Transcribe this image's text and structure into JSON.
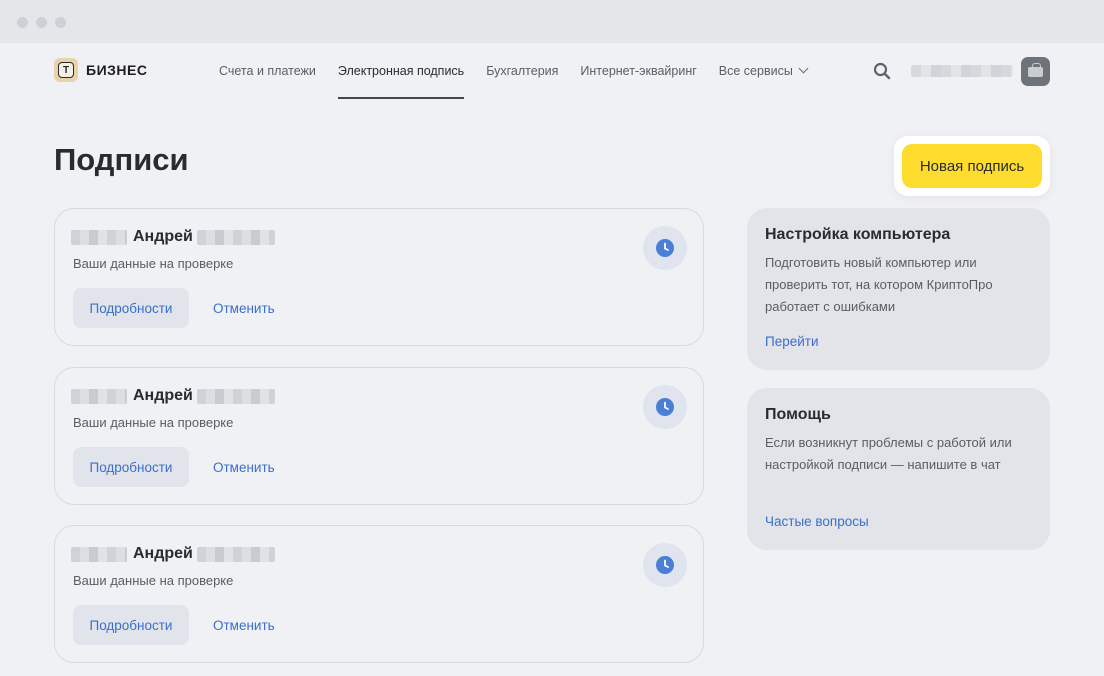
{
  "brand": {
    "logo_letter": "Т",
    "name": "БИЗНЕС"
  },
  "nav": {
    "items": [
      {
        "label": "Счета и платежи"
      },
      {
        "label": "Электронная подпись"
      },
      {
        "label": "Бухгалтерия"
      },
      {
        "label": "Интернет-эквайринг"
      },
      {
        "label": "Все сервисы"
      }
    ],
    "active_index": 1
  },
  "page": {
    "title": "Подписи",
    "new_button": "Новая подпись"
  },
  "signatures": [
    {
      "first_name": "Андрей",
      "status": "Ваши данные на проверке",
      "details_label": "Подробности",
      "cancel_label": "Отменить"
    },
    {
      "first_name": "Андрей",
      "status": "Ваши данные на проверке",
      "details_label": "Подробности",
      "cancel_label": "Отменить"
    },
    {
      "first_name": "Андрей",
      "status": "Ваши данные на проверке",
      "details_label": "Подробности",
      "cancel_label": "Отменить"
    }
  ],
  "side": {
    "setup": {
      "title": "Настройка компьютера",
      "text": "Подготовить новый компьютер или проверить тот, на котором КриптоПро работает с ошибками",
      "link": "Перейти"
    },
    "help": {
      "title": "Помощь",
      "text": "Если возникнут проблемы с работой или настройкой подписи — напишите в чат",
      "link": "Частые вопросы"
    }
  },
  "colors": {
    "accent": "#fddc2e",
    "link": "#3b6fc9",
    "background": "#f0f1f4"
  }
}
